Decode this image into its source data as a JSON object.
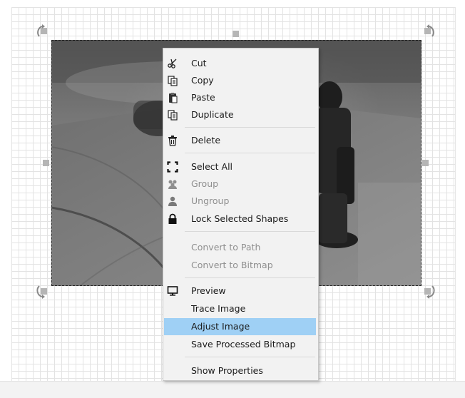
{
  "context_menu": {
    "items": [
      {
        "label": "Cut",
        "icon": "scissors-icon",
        "enabled": true
      },
      {
        "label": "Copy",
        "icon": "copy-icon",
        "enabled": true
      },
      {
        "label": "Paste",
        "icon": "paste-icon",
        "enabled": true
      },
      {
        "label": "Duplicate",
        "icon": "duplicate-icon",
        "enabled": true
      },
      {
        "label": "Delete",
        "icon": "trash-icon",
        "enabled": true
      },
      {
        "label": "Select All",
        "icon": "select-all-icon",
        "enabled": true
      },
      {
        "label": "Group",
        "icon": "group-icon",
        "enabled": false
      },
      {
        "label": "Ungroup",
        "icon": "ungroup-icon",
        "enabled": false
      },
      {
        "label": "Lock Selected Shapes",
        "icon": "lock-icon",
        "enabled": true
      },
      {
        "label": "Convert to Path",
        "icon": "",
        "enabled": false
      },
      {
        "label": "Convert to Bitmap",
        "icon": "",
        "enabled": false
      },
      {
        "label": "Preview",
        "icon": "monitor-icon",
        "enabled": true
      },
      {
        "label": "Trace Image",
        "icon": "",
        "enabled": true
      },
      {
        "label": "Adjust Image",
        "icon": "",
        "enabled": true,
        "highlighted": true
      },
      {
        "label": "Save Processed Bitmap",
        "icon": "",
        "enabled": true
      },
      {
        "label": "Show Properties",
        "icon": "",
        "enabled": true
      }
    ]
  },
  "colors": {
    "highlight": "#9fd0f5",
    "menu_background": "#f2f2f2",
    "disabled_text": "#8f8f8f"
  }
}
